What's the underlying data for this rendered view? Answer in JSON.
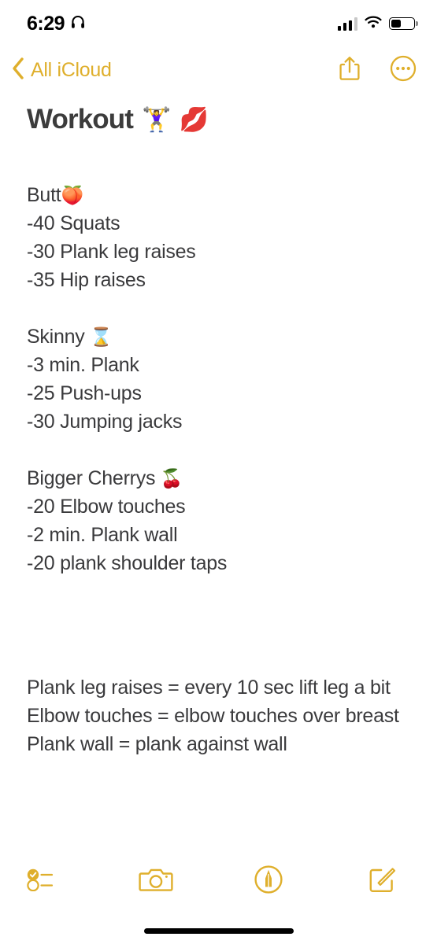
{
  "status_bar": {
    "time": "6:29",
    "headphones_icon": "headphones-icon",
    "cellular_icon": "cellular-signal-icon",
    "wifi_icon": "wifi-icon",
    "battery_icon": "battery-icon",
    "battery_level_percent": 45
  },
  "nav": {
    "back_label": "All iCloud",
    "back_chevron_icon": "chevron-left-icon",
    "share_icon": "share-icon",
    "more_icon": "more-ellipsis-icon",
    "accent_color": "#DFAF2C"
  },
  "note": {
    "title": "Workout",
    "title_emojis": [
      "🏋️‍♀️",
      "💋"
    ],
    "text_color": "#3A3A3C",
    "title_color": "#3C3C3C",
    "sections": [
      {
        "heading": "Butt",
        "heading_emoji": "🍑",
        "items": [
          "-40 Squats",
          "-30 Plank leg raises",
          "-35 Hip raises"
        ]
      },
      {
        "heading": "Skinny ",
        "heading_emoji": "⌛",
        "items": [
          "-3 min. Plank",
          "-25 Push-ups",
          "-30 Jumping jacks"
        ]
      },
      {
        "heading": "Bigger Cherrys ",
        "heading_emoji": "🍒",
        "items": [
          "-20 Elbow touches",
          "-2 min. Plank wall",
          "-20 plank shoulder taps"
        ]
      }
    ],
    "definitions": [
      "Plank leg raises = every 10 sec lift leg a bit",
      "Elbow touches = elbow touches over breast",
      "Plank wall = plank against wall"
    ]
  },
  "toolbar": {
    "checklist_icon": "checklist-icon",
    "camera_icon": "camera-icon",
    "markup_icon": "markup-pen-icon",
    "compose_icon": "compose-icon",
    "accent_color": "#DFAF2C"
  },
  "home_indicator": "home-indicator"
}
